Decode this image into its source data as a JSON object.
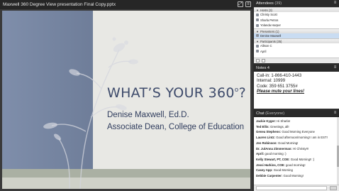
{
  "share_pod": {
    "title": "Maxwell 360 Degree View presentation Final Copy.pptx",
    "icons": [
      "expand-icon",
      "menu-icon"
    ]
  },
  "slide": {
    "title_main": "WHAT’S YOUR 360",
    "title_sup": "o",
    "title_end": "?",
    "line1": "Denise Maxwell, Ed.D.",
    "line2": "Associate Dean, College of Education",
    "colors": {
      "left_panel": "#7888a6",
      "background": "#e8e8e4",
      "title": "#3e4b6b"
    }
  },
  "attendees": {
    "title": "Attendees",
    "count": "(39)",
    "groups": [
      {
        "label": "Hosts (3)",
        "people": [
          "Christy Scott",
          "Sharla Petros",
          "Yolanda Harper"
        ]
      },
      {
        "label": "Presenters (1)",
        "people": [
          "Denise Maxwell"
        ]
      },
      {
        "label": "Participants (35)",
        "people": [
          "Allison C",
          "April"
        ]
      }
    ]
  },
  "notes": {
    "title": "Notes 4",
    "lines": [
      "Call-in: 1-866-410-1443",
      "Internal: 10999",
      "Code: 359 651 3755#"
    ],
    "emphasis": "Please mute your lines!"
  },
  "chat": {
    "title": "Chat",
    "audience": "(Everyone)",
    "messages": [
      {
        "author": "Jackie Kyger:",
        "text": "Hi Sharla!"
      },
      {
        "author": "Ted Ellis:",
        "text": "Greetings, all!"
      },
      {
        "author": "Genea Stephens:",
        "text": "Good Morning Everyone"
      },
      {
        "author": "Lauren Lintz:",
        "text": "Good afternoon/morning! I am in EST!"
      },
      {
        "author": "Jen Robinson:",
        "text": "Good Morning!"
      },
      {
        "author": "Dr. JulAnna Zimmerman:",
        "text": "Hi Christy!!!"
      },
      {
        "author": "April:",
        "text": "good morning :)"
      },
      {
        "author": "Kelly Stewart, PT, COE:",
        "text": "Good Morning!! :)"
      },
      {
        "author": "Jessi Harkins, COE:",
        "text": "good morning!"
      },
      {
        "author": "Casey App:",
        "text": "Good Morning"
      },
      {
        "author": "Debbie Carpenter:",
        "text": "Good Morning!"
      }
    ]
  }
}
